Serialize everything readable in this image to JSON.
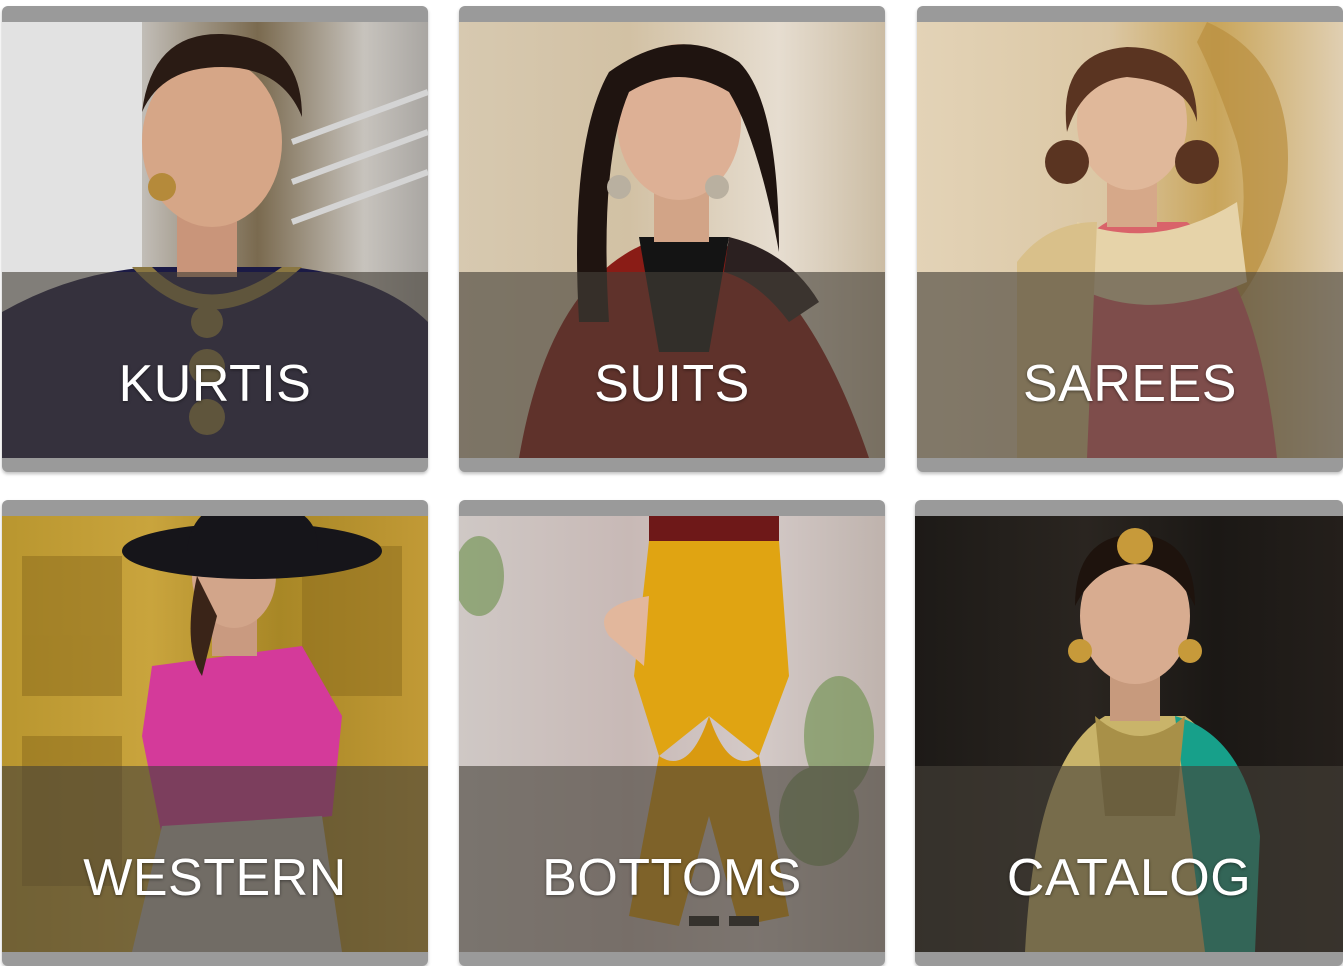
{
  "categories": [
    {
      "label": "KURTIS"
    },
    {
      "label": "SUITS"
    },
    {
      "label": "SAREES"
    },
    {
      "label": "WESTERN"
    },
    {
      "label": "BOTTOMS"
    },
    {
      "label": "CATALOG"
    }
  ],
  "colors": {
    "band_overlay": "#464038",
    "label_text": "#ffffff",
    "tile_border": "#9a9a9a"
  }
}
